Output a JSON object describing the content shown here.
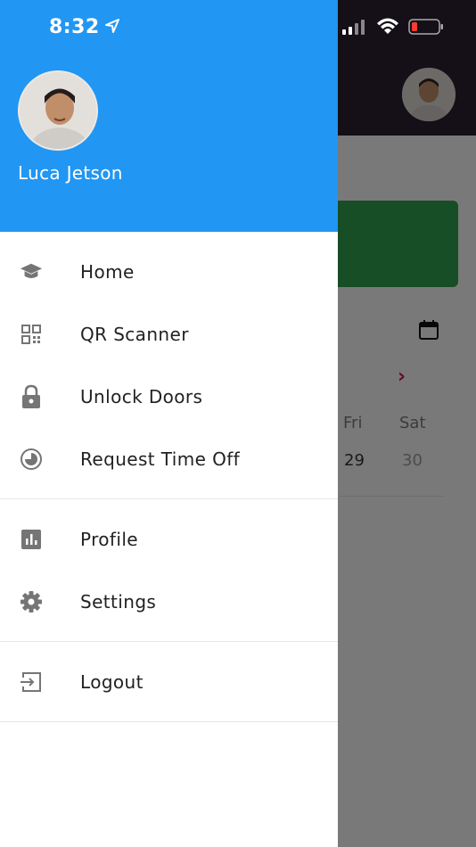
{
  "status_bar": {
    "time": "8:32"
  },
  "background": {
    "days": [
      "Fri",
      "Sat"
    ],
    "dates": [
      "29",
      "30"
    ],
    "accent_green": "#2e9c4a",
    "header_color": "#2b1e30"
  },
  "drawer": {
    "header_color": "#2196f3",
    "user_name": "Luca Jetson",
    "menu_primary": [
      {
        "label": "Home",
        "icon": "graduation-cap-icon"
      },
      {
        "label": "QR Scanner",
        "icon": "qr-code-icon"
      },
      {
        "label": "Unlock Doors",
        "icon": "lock-icon"
      },
      {
        "label": "Request Time Off",
        "icon": "clock-icon"
      }
    ],
    "menu_secondary": [
      {
        "label": "Profile",
        "icon": "bar-chart-icon"
      },
      {
        "label": "Settings",
        "icon": "gear-icon"
      }
    ],
    "menu_tertiary": [
      {
        "label": "Logout",
        "icon": "logout-icon"
      }
    ]
  }
}
